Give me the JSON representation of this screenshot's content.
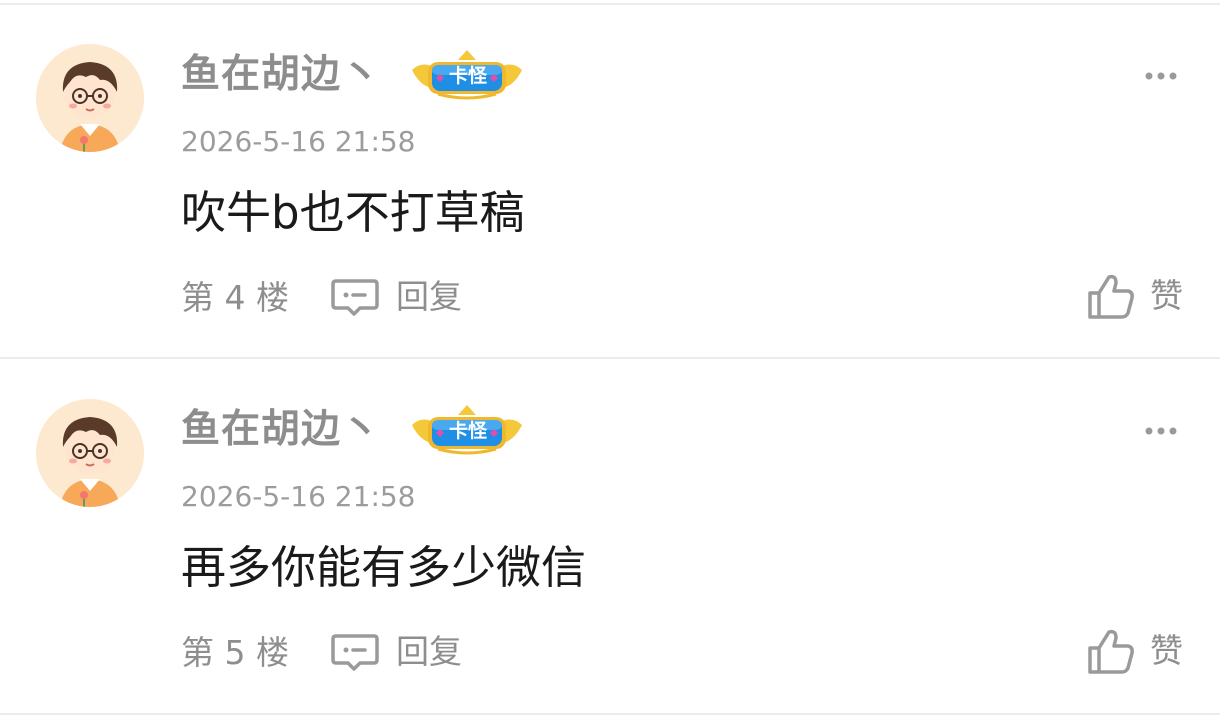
{
  "comments": [
    {
      "username": "鱼在胡边丶",
      "badge": "卡怪",
      "avatar_icon": "cartoon-boy-avatar",
      "timestamp": "2026-5-16 21:58",
      "text": "吹牛b也不打草稿",
      "floor": "第 4 楼",
      "reply_label": "回复",
      "like_label": "赞"
    },
    {
      "username": "鱼在胡边丶",
      "badge": "卡怪",
      "avatar_icon": "cartoon-boy-avatar",
      "timestamp": "2026-5-16 21:58",
      "text": "再多你能有多少微信",
      "floor": "第 5 楼",
      "reply_label": "回复",
      "like_label": "赞"
    }
  ],
  "colors": {
    "username": "#8d8d8d",
    "meta": "#9c9c9c",
    "body_text": "#1a1a1a",
    "divider": "#ececec",
    "avatar_bg": "#fde9cf",
    "badge_blue": "#1f8fe6",
    "badge_gold": "#f5c83a"
  }
}
